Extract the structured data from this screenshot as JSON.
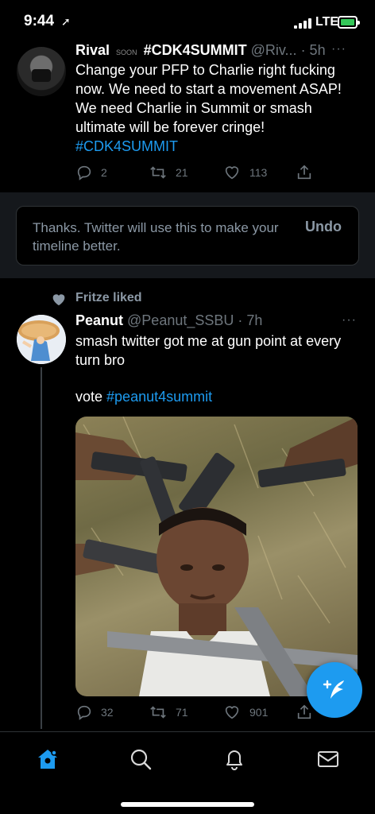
{
  "status_bar": {
    "time": "9:44",
    "network": "LTE"
  },
  "tweet1": {
    "name": "Rival",
    "badge": "SOON",
    "tag": "#CDK4SUMMIT",
    "handle": "@Riv...",
    "time": "· 5h",
    "more": "···",
    "text": "Change your PFP to Charlie right fucking now. We need to start a movement ASAP! We need Charlie in Summit or smash ultimate will be forever cringe!",
    "hashtag": "#CDK4SUMMIT",
    "replies": "2",
    "retweets": "21",
    "likes": "113"
  },
  "feedback": {
    "message": "Thanks. Twitter will use this to make your timeline better.",
    "undo": "Undo"
  },
  "tweet2": {
    "liked_by": "Fritze liked",
    "name": "Peanut",
    "handle": "@Peanut_SSBU",
    "time": "· 7h",
    "more": "···",
    "text": "smash twitter got me at gun point at every turn bro",
    "vote_prefix": "vote ",
    "vote_hashtag": "#peanut4summit",
    "replies": "32",
    "retweets": "71",
    "likes": "901"
  },
  "colors": {
    "accent": "#1d9bf0",
    "background": "#000000",
    "muted": "#6e767d"
  },
  "icons": [
    "home-icon",
    "search-icon",
    "notifications-icon",
    "messages-icon",
    "compose-tweet-icon"
  ]
}
